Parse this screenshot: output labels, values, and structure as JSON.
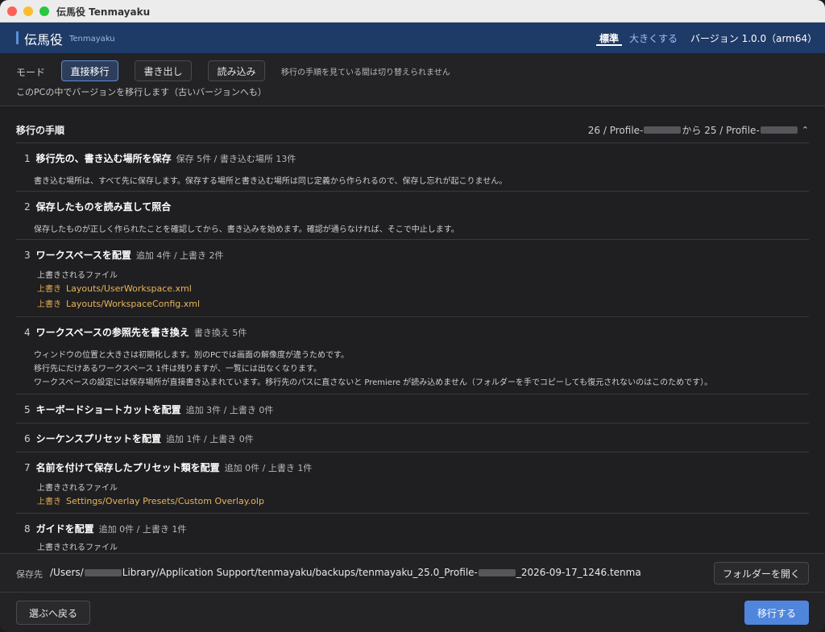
{
  "window": {
    "title": "伝馬役 Tenmayaku"
  },
  "header": {
    "app_name": "伝馬役",
    "app_sub": "Tenmayaku",
    "size_standard": "標準",
    "size_large": "大きくする",
    "version": "バージョン 1.0.0（arm64）"
  },
  "mode": {
    "label": "モード",
    "buttons": [
      "直接移行",
      "書き出し",
      "読み込み"
    ],
    "active": "直接移行",
    "note": "移行の手順を見ている間は切り替えられません",
    "description": "このPCの中でバージョンを移行します（古いバージョンへも）"
  },
  "section": {
    "title": "移行の手順",
    "route_from": "26 / Profile-",
    "route_mid": "から 25 / Profile-",
    "collapse_icon": "chevron-up-icon"
  },
  "steps": [
    {
      "num": "1",
      "name": "移行先の、書き込む場所を保存",
      "meta": "保存 5件 / 書き込む場所 13件",
      "lines": [
        "書き込む場所は、すべて先に保存します。保存する場所と書き込む場所は同じ定義から作られるので、保存し忘れが起こりません。"
      ]
    },
    {
      "num": "2",
      "name": "保存したものを読み直して照合",
      "meta": "",
      "lines": [
        "保存したものが正しく作られたことを確認してから、書き込みを始めます。確認が通らなければ、そこで中止します。"
      ]
    },
    {
      "num": "3",
      "name": "ワークスペースを配置",
      "meta": "追加 4件 / 上書き 2件",
      "sub_label": "上書きされるファイル",
      "files": [
        {
          "tag": "上書き",
          "path": "Layouts/UserWorkspace.xml"
        },
        {
          "tag": "上書き",
          "path": "Layouts/WorkspaceConfig.xml"
        }
      ]
    },
    {
      "num": "4",
      "name": "ワークスペースの参照先を書き換え",
      "meta": "書き換え 5件",
      "lines": [
        "ウィンドウの位置と大きさは初期化します。別のPCでは画面の解像度が違うためです。",
        "移行先にだけあるワークスペース 1件は残りますが、一覧には出なくなります。",
        "ワークスペースの設定には保存場所が直接書き込まれています。移行先のパスに直さないと Premiere が読み込めません（フォルダーを手でコピーしても復元されないのはこのためです）。"
      ]
    },
    {
      "num": "5",
      "name": "キーボードショートカットを配置",
      "meta": "追加 3件 / 上書き 0件"
    },
    {
      "num": "6",
      "name": "シーケンスプリセットを配置",
      "meta": "追加 1件 / 上書き 0件"
    },
    {
      "num": "7",
      "name": "名前を付けて保存したプリセット類を配置",
      "meta": "追加 0件 / 上書き 1件",
      "sub_label": "上書きされるファイル",
      "files": [
        {
          "tag": "上書き",
          "path": "Settings/Overlay Presets/Custom Overlay.olp"
        }
      ]
    },
    {
      "num": "8",
      "name": "ガイドを配置",
      "meta": "追加 0件 / 上書き 1件",
      "sub_label": "上書きされるファイル"
    }
  ],
  "footer": {
    "save_label": "保存先",
    "save_path_a": "/Users/",
    "save_path_b": "Library/Application Support/tenmayaku/backups/tenmayaku_25.0_Profile-",
    "save_path_c": "_2026-09-17_1246.tenma",
    "open_folder": "フォルダーを開く",
    "back": "選ぶへ戻る",
    "migrate": "移行する"
  }
}
